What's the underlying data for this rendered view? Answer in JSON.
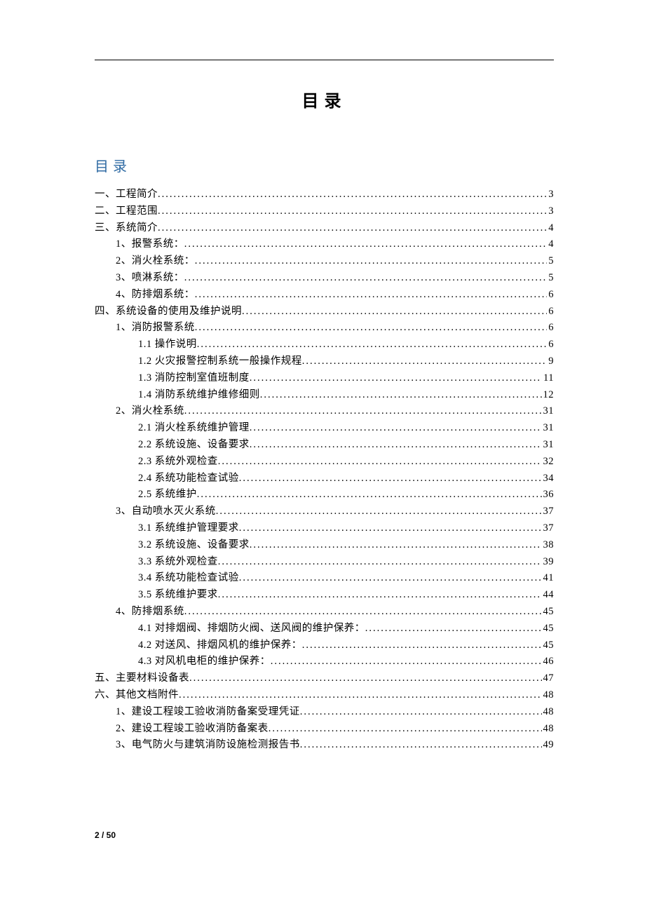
{
  "mainTitle": "目录",
  "sectionTitle": "目录",
  "footer": "2 / 50",
  "toc": [
    {
      "indent": 0,
      "label": "一、工程简介",
      "page": "3"
    },
    {
      "indent": 0,
      "label": "二、工程范围",
      "page": "3"
    },
    {
      "indent": 0,
      "label": "三、系统简介",
      "page": "4"
    },
    {
      "indent": 1,
      "label": "1、报警系统：",
      "page": "4"
    },
    {
      "indent": 1,
      "label": "2、消火栓系统：",
      "page": "5"
    },
    {
      "indent": 1,
      "label": "3、喷淋系统：",
      "page": "5"
    },
    {
      "indent": 1,
      "label": "4、防排烟系统：",
      "page": "6"
    },
    {
      "indent": 0,
      "label": "四、系统设备的使用及维护说明",
      "page": "6"
    },
    {
      "indent": 1,
      "label": "1、消防报警系统",
      "page": "6"
    },
    {
      "indent": 2,
      "label": "1.1 操作说明",
      "page": "6"
    },
    {
      "indent": 2,
      "label": "1.2 火灾报警控制系统一般操作规程",
      "page": "9"
    },
    {
      "indent": 2,
      "label": "1.3 消防控制室值班制度",
      "page": "11"
    },
    {
      "indent": 2,
      "label": "1.4 消防系统维护维修细则",
      "page": "12"
    },
    {
      "indent": 1,
      "label": "2、消火栓系统",
      "page": "31"
    },
    {
      "indent": 2,
      "label": "2.1 消火栓系统维护管理",
      "page": "31"
    },
    {
      "indent": 2,
      "label": "2.2 系统设施、设备要求",
      "page": "31"
    },
    {
      "indent": 2,
      "label": "2.3 系统外观检查",
      "page": "32"
    },
    {
      "indent": 2,
      "label": "2.4 系统功能检查试验",
      "page": "34"
    },
    {
      "indent": 2,
      "label": "2.5 系统维护",
      "page": "36"
    },
    {
      "indent": 1,
      "label": "3、自动喷水灭火系统",
      "page": "37"
    },
    {
      "indent": 2,
      "label": "3.1 系统维护管理要求",
      "page": "37"
    },
    {
      "indent": 2,
      "label": "3.2 系统设施、设备要求",
      "page": "38"
    },
    {
      "indent": 2,
      "label": "3.3 系统外观检查",
      "page": "39"
    },
    {
      "indent": 2,
      "label": "3.4 系统功能检查试验",
      "page": "41"
    },
    {
      "indent": 2,
      "label": "3.5 系统维护要求",
      "page": "44"
    },
    {
      "indent": 1,
      "label": "4、防排烟系统",
      "page": "45"
    },
    {
      "indent": 2,
      "label": "4.1 对排烟阀、排烟防火阀、送风阀的维护保养：",
      "page": "45"
    },
    {
      "indent": 2,
      "label": "4.2 对送风、排烟风机的维护保养：",
      "page": "45"
    },
    {
      "indent": 2,
      "label": "4.3 对风机电柜的维护保养：",
      "page": "46"
    },
    {
      "indent": 0,
      "label": "五、主要材料设备表",
      "page": "47"
    },
    {
      "indent": 0,
      "label": "六、其他文档附件",
      "page": "48"
    },
    {
      "indent": 1,
      "label": "1、建设工程竣工验收消防备案受理凭证",
      "page": "48"
    },
    {
      "indent": 1,
      "label": "2、建设工程竣工验收消防备案表",
      "page": "48"
    },
    {
      "indent": 1,
      "label": "3、电气防火与建筑消防设施检测报告书",
      "page": "49"
    }
  ]
}
